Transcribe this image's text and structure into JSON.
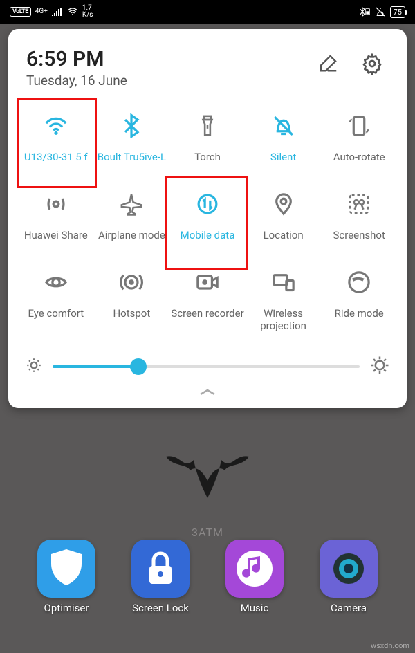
{
  "status_bar": {
    "volte": "VoLTE",
    "signal_type": "4G+",
    "speed_value": "1.7",
    "speed_unit": "K/s",
    "battery": "75"
  },
  "panel": {
    "time": "6:59 PM",
    "date": "Tuesday, 16 June",
    "brightness_percent": 28
  },
  "tiles": [
    {
      "icon": "wifi",
      "label": "U13/30-31 5 f",
      "active": true,
      "highlight": true,
      "multi": false
    },
    {
      "icon": "bluetooth",
      "label": "Boult Tru5ive-L",
      "active": true,
      "highlight": false,
      "multi": false
    },
    {
      "icon": "torch",
      "label": "Torch",
      "active": false,
      "highlight": false,
      "multi": false
    },
    {
      "icon": "silent",
      "label": "Silent",
      "active": true,
      "highlight": false,
      "multi": false
    },
    {
      "icon": "autorotate",
      "label": "Auto-rotate",
      "active": false,
      "highlight": false,
      "multi": false
    },
    {
      "icon": "huaweishare",
      "label": "Huawei Share",
      "active": false,
      "highlight": false,
      "multi": false
    },
    {
      "icon": "airplane",
      "label": "Airplane mode",
      "active": false,
      "highlight": false,
      "multi": false
    },
    {
      "icon": "mobiledata",
      "label": "Mobile data",
      "active": true,
      "highlight": true,
      "multi": false
    },
    {
      "icon": "location",
      "label": "Location",
      "active": false,
      "highlight": false,
      "multi": false
    },
    {
      "icon": "screenshot",
      "label": "Screenshot",
      "active": false,
      "highlight": false,
      "multi": false
    },
    {
      "icon": "eyecomfort",
      "label": "Eye comfort",
      "active": false,
      "highlight": false,
      "multi": false
    },
    {
      "icon": "hotspot",
      "label": "Hotspot",
      "active": false,
      "highlight": false,
      "multi": false
    },
    {
      "icon": "screenrec",
      "label": "Screen recorder",
      "active": false,
      "highlight": false,
      "multi": true
    },
    {
      "icon": "projection",
      "label": "Wireless projection",
      "active": false,
      "highlight": false,
      "multi": true
    },
    {
      "icon": "ridemode",
      "label": "Ride mode",
      "active": false,
      "highlight": false,
      "multi": false
    }
  ],
  "apps": [
    {
      "name": "Optimiser",
      "bg": "#2f9ee8",
      "glyph": "shield"
    },
    {
      "name": "Screen Lock",
      "bg": "#3369d6",
      "glyph": "lock"
    },
    {
      "name": "Music",
      "bg": "#a448d8",
      "glyph": "music"
    },
    {
      "name": "Camera",
      "bg": "#6b63d6",
      "glyph": "camera"
    }
  ],
  "wallpaper_text": "3ATM",
  "watermark": "wsxdn.com"
}
